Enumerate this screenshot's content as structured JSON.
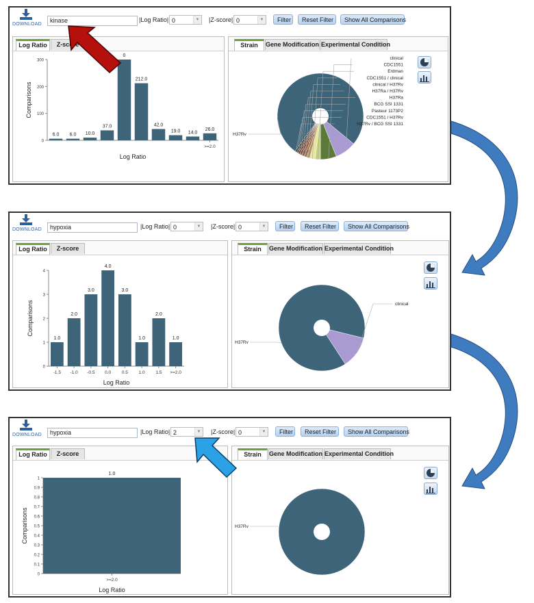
{
  "colors": {
    "bar": "#3d6478",
    "pie_main": "#3d6478",
    "clinical": "#a99bd1",
    "cdc1551": "#5b7a3a",
    "erdman": "#c7cf7a",
    "cdc_clinical": "#e4e69a",
    "clinical_h37rv": "#b69064",
    "h37ra_h37rv": "#9b6c44",
    "h37ra": "#8d5a3a",
    "bcg": "#7a4535",
    "pasteur": "#5b3d30",
    "cdc_h37rv": "#4a3a35",
    "h37rv_bcg": "#2e2a2a",
    "arrow_red": "#b5100c",
    "arrow_blue": "#2ba2e6",
    "curve_arrow": "#3f7bbf",
    "tab_accent": "#6aa13a"
  },
  "icons": {
    "download": "download-icon",
    "pie_toggle": "pie-chart-icon",
    "bar_toggle": "bar-chart-icon"
  },
  "panels": [
    {
      "download_label": "DOWNLOAD",
      "search_value": "kinase",
      "log_ratio_label": "|Log Ratio|:",
      "log_ratio_value": "0",
      "z_score_label": "|Z-score|:",
      "z_score_value": "0",
      "filter_label": "Filter",
      "reset_label": "Reset Filter",
      "show_all_label": "Show All Comparisons",
      "left_tabs": [
        "Log Ratio",
        "Z-score"
      ],
      "right_tabs": [
        "Strain",
        "Gene Modification",
        "Experimental Condition"
      ],
      "chart_data": {
        "type": "bar",
        "ylabel": "Comparisons",
        "xlabel": "Log Ratio",
        "categories": [
          "",
          "",
          "",
          "",
          "",
          "",
          "",
          "",
          "",
          ">=2.0"
        ],
        "values": [
          6,
          6,
          10,
          37,
          300,
          212,
          42,
          19,
          14,
          26
        ],
        "data_labels": [
          "6.0",
          "6.0",
          "10.0",
          "37.0",
          "0",
          "212.0",
          "42.0",
          "19.0",
          "14.0",
          "26.0"
        ],
        "yticks": [
          "0",
          "100",
          "200",
          "300"
        ],
        "ylim": [
          0,
          300
        ]
      },
      "pie_data": {
        "type": "pie",
        "labels": [
          "H37Rv",
          "clinical",
          "CDC1551",
          "Erdman",
          "CDC1551 / clinical",
          "clinical / H37Rv",
          "H37Ra / H37Rv",
          "H37Ra",
          "BCG SSI 1331",
          "Pasteur 1173P2",
          "CDC1551 / H37Rv",
          "H37Rv / BCG SSI 1331"
        ],
        "values": [
          76,
          8,
          6,
          2,
          2,
          1.2,
          1,
          1,
          0.8,
          0.7,
          0.6,
          0.7
        ]
      }
    },
    {
      "download_label": "DOWNLOAD",
      "search_value": "hypoxia",
      "log_ratio_label": "|Log Ratio|:",
      "log_ratio_value": "0",
      "z_score_label": "|Z-score|:",
      "z_score_value": "0",
      "filter_label": "Filter",
      "reset_label": "Reset Filter",
      "show_all_label": "Show All Comparisons",
      "left_tabs": [
        "Log Ratio",
        "Z-score"
      ],
      "right_tabs": [
        "Strain",
        "Gene Modification",
        "Experimental Condition"
      ],
      "chart_data": {
        "type": "bar",
        "ylabel": "Comparisons",
        "xlabel": "Log Ratio",
        "categories": [
          "-1.5",
          "-1.0",
          "-0.5",
          "0.0",
          "0.5",
          "1.0",
          "1.5",
          ">=2.0"
        ],
        "values": [
          1,
          2,
          3,
          4,
          3,
          1,
          2,
          1
        ],
        "data_labels": [
          "1.0",
          "2.0",
          "3.0",
          "4.0",
          "3.0",
          "1.0",
          "2.0",
          "1.0"
        ],
        "yticks": [
          "0",
          "1",
          "2",
          "3",
          "4"
        ],
        "ylim": [
          0,
          4
        ]
      },
      "pie_data": {
        "type": "pie",
        "labels": [
          "H37Rv",
          "clinical"
        ],
        "values": [
          88,
          12
        ]
      }
    },
    {
      "download_label": "DOWNLOAD",
      "search_value": "hypoxia",
      "log_ratio_label": "|Log Ratio|:",
      "log_ratio_value": "2",
      "z_score_label": "|Z-score|:",
      "z_score_value": "0",
      "filter_label": "Filter",
      "reset_label": "Reset Filter",
      "show_all_label": "Show All Comparisons",
      "left_tabs": [
        "Log Ratio",
        "Z-score"
      ],
      "right_tabs": [
        "Strain",
        "Gene Modification",
        "Experimental Condition"
      ],
      "chart_data": {
        "type": "bar",
        "ylabel": "Comparisons",
        "xlabel": "Log Ratio",
        "categories": [
          ">=2.0"
        ],
        "values": [
          1
        ],
        "data_labels": [
          "1.0"
        ],
        "yticks": [
          "0",
          "0.1",
          "0.2",
          "0.3",
          "0.4",
          "0.5",
          "0.6",
          "0.7",
          "0.8",
          "0.9",
          "1"
        ],
        "ylim": [
          0,
          1
        ]
      },
      "pie_data": {
        "type": "pie",
        "labels": [
          "H37Rv"
        ],
        "values": [
          100
        ]
      }
    }
  ]
}
